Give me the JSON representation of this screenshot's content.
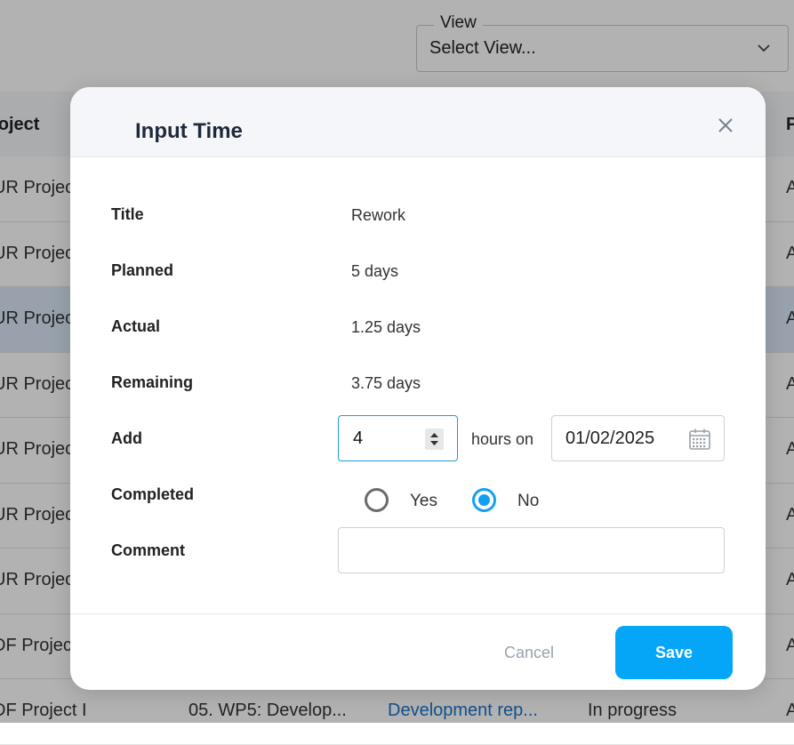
{
  "background": {
    "view": {
      "legend": "View",
      "value": "Select View..."
    },
    "table": {
      "header_project": "roject",
      "header_right": "P",
      "rows": [
        {
          "project": "UR Projec",
          "right": "A"
        },
        {
          "project": "UR Projec",
          "right": "A"
        },
        {
          "project": "UR Projec",
          "right": "A"
        },
        {
          "project": "UR Projec",
          "right": "A"
        },
        {
          "project": "UR Projec",
          "right": "A"
        },
        {
          "project": "UR Projec",
          "right": "A"
        },
        {
          "project": "UR Projec",
          "right": "A"
        },
        {
          "project": "DF Projec",
          "right": "A"
        }
      ],
      "last_row": {
        "project": "DF Project I",
        "workpackage": "05. WP5: Develop...",
        "deliverable": "Development rep...",
        "status": "In progress",
        "right": "A"
      }
    }
  },
  "modal": {
    "title": "Input Time",
    "fields": {
      "title_label": "Title",
      "title_value": "Rework",
      "planned_label": "Planned",
      "planned_value": "5 days",
      "actual_label": "Actual",
      "actual_value": "1.25 days",
      "remaining_label": "Remaining",
      "remaining_value": "3.75 days",
      "add_label": "Add",
      "add_value": "4",
      "hours_on": "hours on",
      "date_value": "01/02/2025",
      "completed_label": "Completed",
      "yes_label": "Yes",
      "no_label": "No",
      "completed_selected": "No",
      "comment_label": "Comment",
      "comment_value": ""
    },
    "footer": {
      "cancel_label": "Cancel",
      "save_label": "Save"
    }
  },
  "colors": {
    "accent": "#05a6f7",
    "radio_selected": "#14a0f0",
    "link": "#1a73c9"
  }
}
